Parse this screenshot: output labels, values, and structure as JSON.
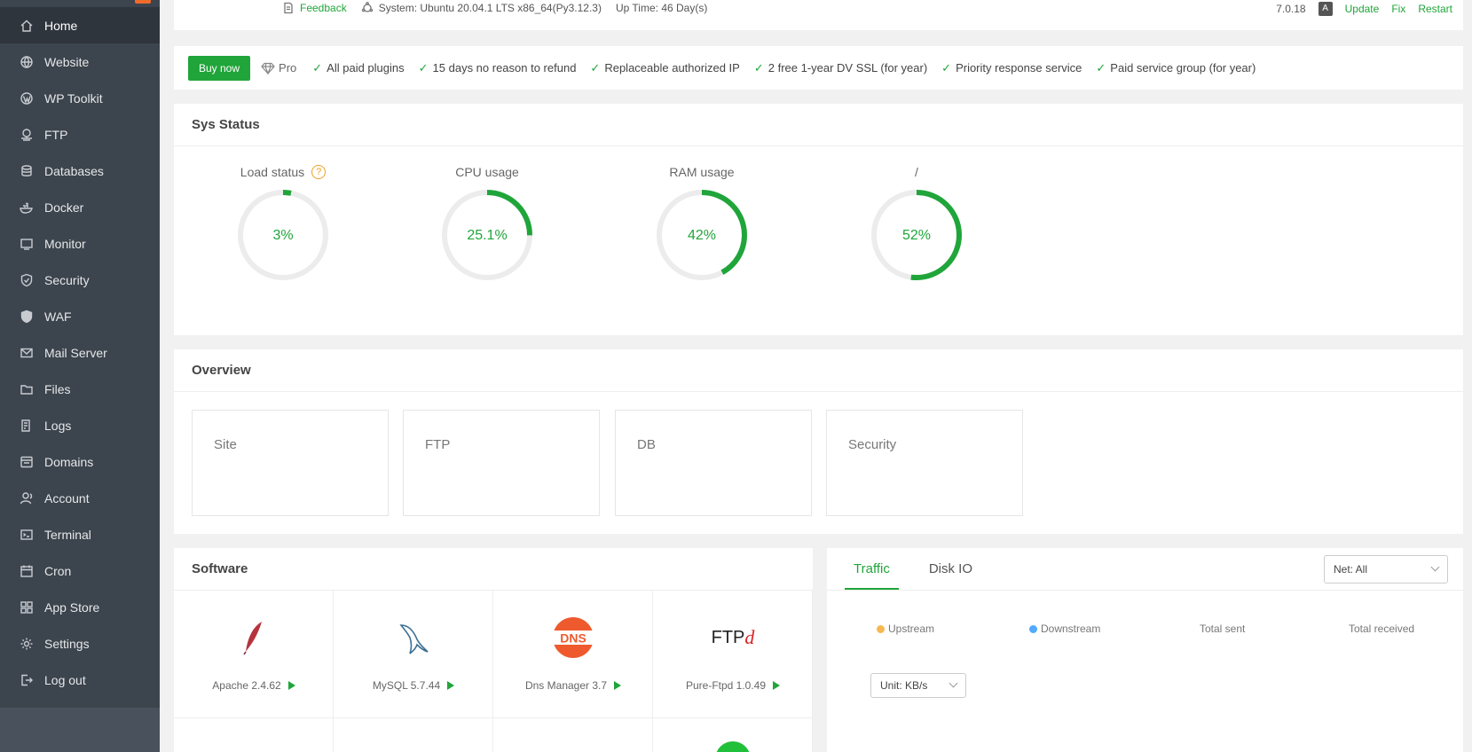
{
  "sidebar": {
    "items": [
      {
        "label": "Home",
        "icon": "home-icon"
      },
      {
        "label": "Website",
        "icon": "globe-icon"
      },
      {
        "label": "WP Toolkit",
        "icon": "wordpress-icon"
      },
      {
        "label": "FTP",
        "icon": "ftp-icon"
      },
      {
        "label": "Databases",
        "icon": "database-icon"
      },
      {
        "label": "Docker",
        "icon": "docker-icon"
      },
      {
        "label": "Monitor",
        "icon": "monitor-icon"
      },
      {
        "label": "Security",
        "icon": "shield-icon"
      },
      {
        "label": "WAF",
        "icon": "waf-icon"
      },
      {
        "label": "Mail Server",
        "icon": "mail-icon"
      },
      {
        "label": "Files",
        "icon": "folder-icon"
      },
      {
        "label": "Logs",
        "icon": "logs-icon"
      },
      {
        "label": "Domains",
        "icon": "domains-icon"
      },
      {
        "label": "Account",
        "icon": "user-icon"
      },
      {
        "label": "Terminal",
        "icon": "terminal-icon"
      },
      {
        "label": "Cron",
        "icon": "cron-icon"
      },
      {
        "label": "App Store",
        "icon": "app-store-icon"
      },
      {
        "label": "Settings",
        "icon": "gear-icon"
      },
      {
        "label": "Log out",
        "icon": "logout-icon"
      }
    ]
  },
  "topbar": {
    "feedback": "Feedback",
    "system": "System: Ubuntu 20.04.1 LTS x86_64(Py3.12.3)",
    "uptime": "Up Time: 46 Day(s)",
    "version": "7.0.18",
    "update": "Update",
    "fix": "Fix",
    "restart": "Restart"
  },
  "pro": {
    "buy": "Buy now",
    "pro_label": "Pro",
    "features": [
      "All paid plugins",
      "15 days no reason to refund",
      "Replaceable authorized IP",
      "2 free 1-year DV SSL (for year)",
      "Priority response service",
      "Paid service group (for year)"
    ]
  },
  "sys_status": {
    "title": "Sys Status",
    "gauges": [
      {
        "label": "Load status",
        "value": "3%",
        "percent": 3,
        "help": "?"
      },
      {
        "label": "CPU usage",
        "value": "25.1%",
        "percent": 25.1
      },
      {
        "label": "RAM usage",
        "value": "42%",
        "percent": 42
      },
      {
        "label": "/",
        "value": "52%",
        "percent": 52
      }
    ]
  },
  "overview": {
    "title": "Overview",
    "cards": [
      "Site",
      "FTP",
      "DB",
      "Security"
    ]
  },
  "software": {
    "title": "Software",
    "items": [
      {
        "label": "Apache 2.4.62",
        "icon": "apache-feather-icon"
      },
      {
        "label": "MySQL 5.7.44",
        "icon": "mysql-dolphin-icon"
      },
      {
        "label": "Dns Manager 3.7",
        "icon": "dns-icon"
      },
      {
        "label": "Pure-Ftpd 1.0.49",
        "icon": "ftpd-icon"
      }
    ],
    "dns_text": "DNS",
    "ftpd_text": "FTP",
    "ftpd_d": "d"
  },
  "traffic": {
    "tabs": [
      "Traffic",
      "Disk IO"
    ],
    "net_select": "Net: All",
    "unit_select": "Unit: KB/s",
    "legend": [
      "Upstream",
      "Downstream",
      "Total sent",
      "Total received"
    ],
    "colors": {
      "upstream": "#f7b851",
      "downstream": "#52a9ff"
    }
  },
  "colors": {
    "accent": "#20a53a",
    "sidebar": "#3c444d",
    "badge": "#ef6b2c"
  }
}
